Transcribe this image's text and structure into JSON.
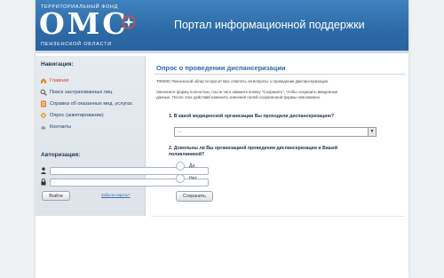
{
  "header": {
    "logo_top": "ТЕРРИТОРИАЛЬНЫЙ ФОНД",
    "logo_main": "ОМС",
    "logo_bottom": "ПЕНЗЕНСКОЙ ОБЛАСТИ",
    "portal_title": "Портал информационной поддержки"
  },
  "sidebar": {
    "nav_heading": "Навигация:",
    "items": [
      {
        "label": "Главная",
        "icon": "home-icon",
        "active": true
      },
      {
        "label": "Поиск застрахованных лиц",
        "icon": "search-icon",
        "active": false
      },
      {
        "label": "Справка об оказанных мед. услугах",
        "icon": "document-icon",
        "active": false
      },
      {
        "label": "Опрос (анкетирование)",
        "icon": "survey-icon",
        "active": false
      },
      {
        "label": "Контакты",
        "icon": "contacts-icon",
        "active": false
      }
    ],
    "auth_heading": "Авторизация:",
    "login_placeholder": "",
    "password_placeholder": "",
    "login_button": "Войти",
    "forgot_link": "Забыли пароль?"
  },
  "main": {
    "title": "Опрос о проведении диспансеризации",
    "intro": "ТФОМС Пензенской области просит Вас ответить на вопросы о проведении Диспансеризации.",
    "instruction_line1": "Заполните форму полностью, после чего нажмите кнопку \"Сохранить\", чтобы сохранить введенные",
    "instruction_line2": "данные. После этих действий изменить значения полей сохраненной формы невозможно.",
    "question1": "1. В какой медицинской организации Вы проходили диспансеризацию?",
    "select_value": "...",
    "question2_line1": "2. Довольны ли Вы организацией проведения диспансеризации и Вашей",
    "question2_line2": "поликлиникой?",
    "option_yes": "Да",
    "option_no": "Нет",
    "save_button": "Сохранить"
  },
  "colors": {
    "header_blue": "#2c6aa6",
    "link_blue": "#2c67a8",
    "active_red": "#c63b2a"
  }
}
